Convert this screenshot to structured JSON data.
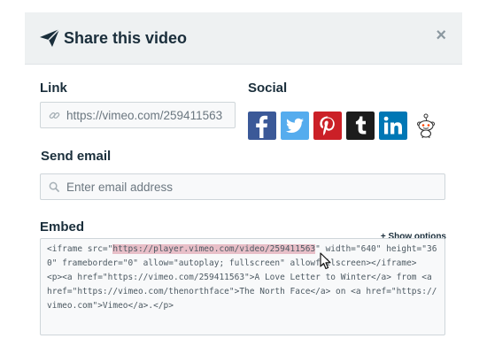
{
  "dialog": {
    "title": "Share this video",
    "close_symbol": "×",
    "icons": {
      "title": "paper-plane-icon",
      "close": "close-icon"
    }
  },
  "link": {
    "label": "Link",
    "value": "https://vimeo.com/259411563",
    "icon": "link-icon"
  },
  "social": {
    "label": "Social",
    "items": [
      {
        "name": "facebook",
        "glyph": "f",
        "color": "#3b5998"
      },
      {
        "name": "twitter",
        "glyph": "bird",
        "color": "#55acee"
      },
      {
        "name": "pinterest",
        "glyph": "P",
        "color": "#cb2027"
      },
      {
        "name": "tumblr",
        "glyph": "t",
        "color": "#1a1a1a"
      },
      {
        "name": "linkedin",
        "glyph": "in",
        "color": "#0077b5"
      },
      {
        "name": "reddit",
        "glyph": "alien",
        "color": "#ff4500"
      }
    ]
  },
  "email": {
    "label": "Send email",
    "placeholder": "Enter email address",
    "icon": "search-icon"
  },
  "embed": {
    "label": "Embed",
    "show_options": "+ Show options",
    "code_pre": "<iframe src=\"",
    "code_highlight": "https://player.vimeo.com/video/259411563",
    "code_post": "\" width=\"640\" height=\"360\" frameborder=\"0\" allow=\"autoplay; fullscreen\" allowfullscreen></iframe>\n<p><a href=\"https://vimeo.com/259411563\">A Love Letter to Winter</a> from <a href=\"https://vimeo.com/thenorthface\">The North Face</a> on <a href=\"https://vimeo.com\">Vimeo</a>.</p>"
  },
  "colors": {
    "header_bg": "#eef1f2",
    "text": "#1a2e3b",
    "highlight": "#e8bfc8"
  }
}
